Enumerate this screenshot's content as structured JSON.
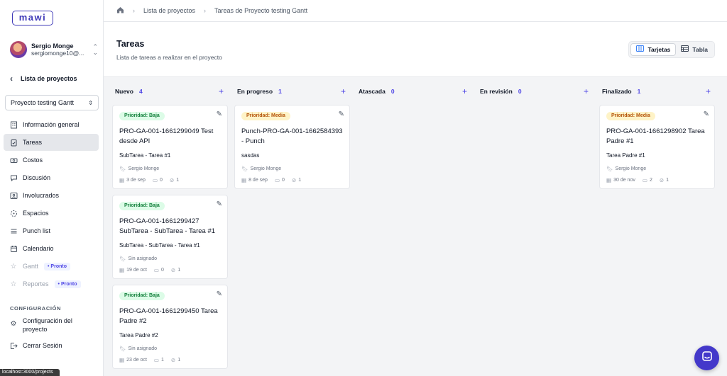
{
  "app": {
    "logo": "mawi"
  },
  "user": {
    "name": "Sergio Monge",
    "email": "sergiomonge10@..."
  },
  "sidebar": {
    "back_label": "Lista de proyectos",
    "project": "Proyecto testing Gantt",
    "items": [
      {
        "label": "Información general",
        "icon": "building-icon"
      },
      {
        "label": "Tareas",
        "icon": "clipboard-icon",
        "active": true
      },
      {
        "label": "Costos",
        "icon": "money-icon"
      },
      {
        "label": "Discusión",
        "icon": "chat-icon"
      },
      {
        "label": "Involucrados",
        "icon": "contacts-icon"
      },
      {
        "label": "Espacios",
        "icon": "spaces-icon"
      },
      {
        "label": "Punch list",
        "icon": "list-icon"
      },
      {
        "label": "Calendario",
        "icon": "calendar-icon"
      },
      {
        "label": "Gantt",
        "icon": "star-icon",
        "badge": "Pronto",
        "disabled": true
      },
      {
        "label": "Reportes",
        "icon": "star-icon",
        "badge": "Pronto",
        "disabled": true
      }
    ],
    "section_label": "CONFIGURACIÓN",
    "config_label": "Configuración del proyecto",
    "logout_label": "Cerrar Sesión"
  },
  "status_url": "localhost:3000/projects",
  "breadcrumb": {
    "item1": "Lista de proyectos",
    "item2": "Tareas de Proyecto testing Gantt"
  },
  "header": {
    "title": "Tareas",
    "subtitle": "Lista de tareas a realizar en el proyecto"
  },
  "view_toggle": {
    "cards": "Tarjetas",
    "table": "Tabla"
  },
  "columns": [
    {
      "name": "Nuevo",
      "count": "4",
      "cards": [
        {
          "priority": "Prioridad: Baja",
          "level": "baja",
          "title": "PRO-GA-001-1661299049 Test desde API",
          "parent": "SubTarea - Tarea #1",
          "assignee": "Sergio Monge",
          "date": "3 de sep",
          "comments": "0",
          "attachments": "1"
        },
        {
          "priority": "Prioridad: Baja",
          "level": "baja",
          "title": "PRO-GA-001-1661299427 SubTarea - SubTarea - Tarea #1",
          "parent": "SubTarea - SubTarea - Tarea #1",
          "assignee": "Sin asignado",
          "date": "19 de oct",
          "comments": "0",
          "attachments": "1"
        },
        {
          "priority": "Prioridad: Baja",
          "level": "baja",
          "title": "PRO-GA-001-1661299450 Tarea Padre #2",
          "parent": "Tarea Padre #2",
          "assignee": "Sin asignado",
          "date": "23 de oct",
          "comments": "1",
          "attachments": "1"
        }
      ]
    },
    {
      "name": "En progreso",
      "count": "1",
      "cards": [
        {
          "priority": "Prioridad: Media",
          "level": "media",
          "title": "Punch-PRO-GA-001-1662584393 - Punch",
          "parent": "sasdas",
          "assignee": "Sergio Monge",
          "date": "8 de sep",
          "comments": "0",
          "attachments": "1"
        }
      ]
    },
    {
      "name": "Atascada",
      "count": "0",
      "cards": []
    },
    {
      "name": "En revisión",
      "count": "0",
      "cards": []
    },
    {
      "name": "Finalizado",
      "count": "1",
      "cards": [
        {
          "priority": "Prioridad: Media",
          "level": "media",
          "title": "PRO-GA-001-1661298902 Tarea Padre #1",
          "parent": "Tarea Padre #1",
          "assignee": "Sergio Monge",
          "date": "30 de nov",
          "comments": "2",
          "attachments": "1"
        }
      ]
    }
  ],
  "colors": {
    "accent": "#4f46e5",
    "brand": "#3f3ab8",
    "fab": "#4338ca"
  }
}
